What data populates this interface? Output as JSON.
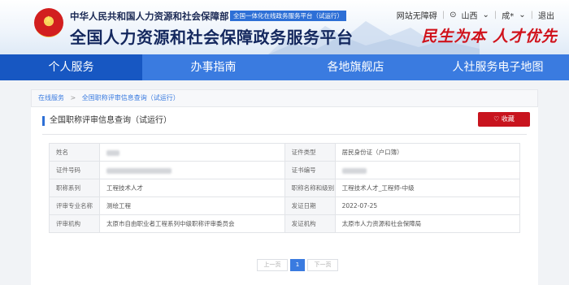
{
  "header": {
    "ministry": "中华人民共和国人力资源和社会保障部",
    "tag": "全国一体化在线政务服务平台（试运行）",
    "platform_title": "全国人力资源和社会保障政务服务平台",
    "slogan": "民生为本 人才优先",
    "accessibility_link": "网站无障碍",
    "region": "山西",
    "user": "成*",
    "logout": "退出"
  },
  "nav": {
    "items": [
      {
        "label": "个人服务"
      },
      {
        "label": "办事指南"
      },
      {
        "label": "各地旗舰店"
      },
      {
        "label": "人社服务电子地图"
      }
    ]
  },
  "breadcrumb": {
    "home": "在线服务",
    "current": "全国职称评审信息查询（试运行）"
  },
  "card": {
    "title": "全国职称评审信息查询（试运行）",
    "favorite_label": "收藏"
  },
  "table": {
    "rows": [
      {
        "label1": "姓名",
        "value1": "",
        "label2": "证件类型",
        "value2": "居民身份证（户口簿）"
      },
      {
        "label1": "证件号码",
        "value1": "",
        "label2": "证书编号",
        "value2": ""
      },
      {
        "label1": "职称系列",
        "value1": "工程技术人才",
        "label2": "职称名称和级别",
        "value2": "工程技术人才_工程师-中级"
      },
      {
        "label1": "评审专业名称",
        "value1": "测绘工程",
        "label2": "发证日期",
        "value2": "2022-07-25"
      },
      {
        "label1": "评审机构",
        "value1": "太原市自由职业者工程系列中级职称评审委员会",
        "label2": "发证机构",
        "value2": "太原市人力资源和社会保障局"
      }
    ]
  },
  "pager": {
    "prev": "上一页",
    "page": "1",
    "next": "下一页"
  },
  "colors": {
    "nav_bg": "#3a7be0",
    "nav_active": "#1757c2",
    "favorite_bg": "#c8141e",
    "slogan": "#d0121b"
  }
}
